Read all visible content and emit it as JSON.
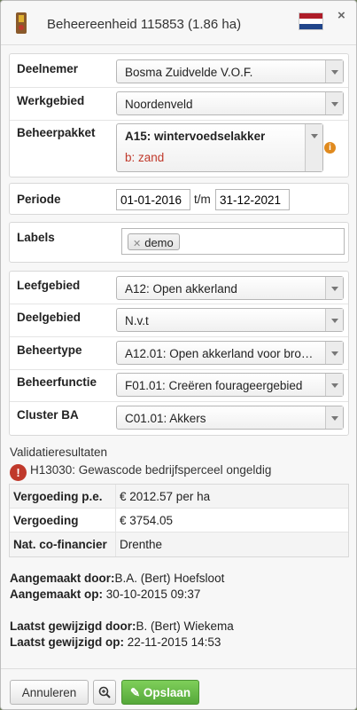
{
  "header": {
    "title": "Beheereenheid 115853 (1.86 ha)",
    "close_icon": "×"
  },
  "form1": {
    "deelnemer": {
      "label": "Deelnemer",
      "value": "Bosma Zuidvelde V.O.F."
    },
    "werkgebied": {
      "label": "Werkgebied",
      "value": "Noordenveld"
    },
    "beheerpakket": {
      "label": "Beheerpakket",
      "value": "A15: wintervoedselakker",
      "sub": "b: zand"
    }
  },
  "periode": {
    "label": "Periode",
    "start": "01-01-2016",
    "sep": "t/m",
    "end": "31-12-2021"
  },
  "labels": {
    "label": "Labels",
    "tags": [
      "demo"
    ]
  },
  "form2": {
    "leefgebied": {
      "label": "Leefgebied",
      "value": "A12: Open akkerland"
    },
    "deelgebied": {
      "label": "Deelgebied",
      "value": "N.v.t"
    },
    "beheertype": {
      "label": "Beheertype",
      "value": "A12.01: Open akkerland voor bro…"
    },
    "beheerfunctie": {
      "label": "Beheerfunctie",
      "value": "F01.01: Creëren fourageergebied"
    },
    "cluster": {
      "label": "Cluster BA",
      "value": "C01.01: Akkers"
    }
  },
  "validation": {
    "title": "Validatieresultaten",
    "error": "H13030: Gewascode bedrijfsperceel ongeldig",
    "rows": [
      {
        "label": "Vergoeding p.e.",
        "value": "€ 2012.57 per ha"
      },
      {
        "label": "Vergoeding",
        "value": "€ 3754.05"
      },
      {
        "label": "Nat. co-financier",
        "value": "Drenthe"
      }
    ]
  },
  "meta": {
    "created_by_label": "Aangemaakt door:",
    "created_by": "B.A. (Bert) Hoefsloot",
    "created_on_label": "Aangemaakt op:",
    "created_on": "30-10-2015 09:37",
    "modified_by_label": "Laatst gewijzigd door:",
    "modified_by": "B. (Bert) Wiekema",
    "modified_on_label": "Laatst gewijzigd op:",
    "modified_on": "22-11-2015 14:53"
  },
  "footer": {
    "cancel": "Annuleren",
    "save": "Opslaan"
  },
  "colors": {
    "error": "#c0392b",
    "save": "#5cb83f",
    "info": "#e08a1e",
    "sub_text": "#c0392b"
  }
}
